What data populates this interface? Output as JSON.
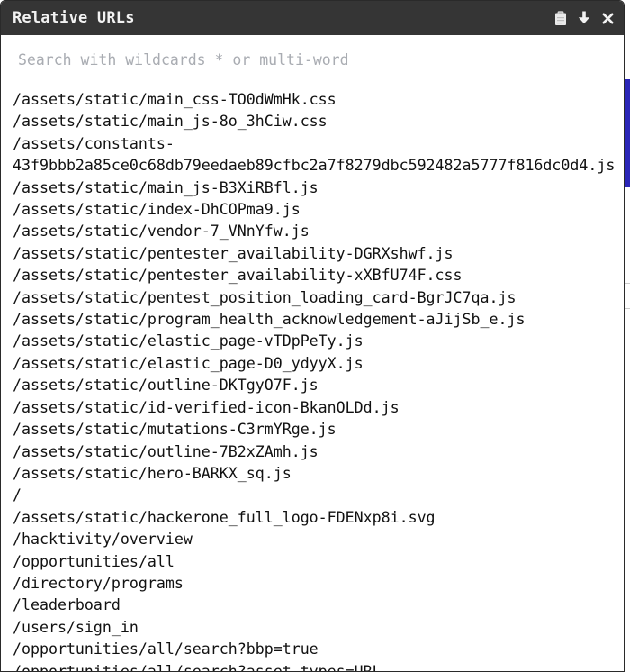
{
  "panel": {
    "title": "Relative URLs",
    "icons": [
      "clipboard-icon",
      "download-icon",
      "close-icon"
    ]
  },
  "search": {
    "placeholder": "Search with wildcards * or multi-word",
    "value": ""
  },
  "urls": [
    "/assets/static/main_css-TO0dWmHk.css",
    "/assets/static/main_js-8o_3hCiw.css",
    "/assets/constants-",
    "43f9bbb2a85ce0c68db79eedaeb89cfbc2a7f8279dbc592482a5777f816dc0d4.js",
    "/assets/static/main_js-B3XiRBfl.js",
    "/assets/static/index-DhCOPma9.js",
    "/assets/static/vendor-7_VNnYfw.js",
    "/assets/static/pentester_availability-DGRXshwf.js",
    "/assets/static/pentester_availability-xXBfU74F.css",
    "/assets/static/pentest_position_loading_card-BgrJC7qa.js",
    "/assets/static/program_health_acknowledgement-aJijSb_e.js",
    "/assets/static/elastic_page-vTDpPeTy.js",
    "/assets/static/elastic_page-D0_ydyyX.js",
    "/assets/static/outline-DKTgyO7F.js",
    "/assets/static/id-verified-icon-BkanOLDd.js",
    "/assets/static/mutations-C3rmYRge.js",
    "/assets/static/outline-7B2xZAmh.js",
    "/assets/static/hero-BARKX_sq.js",
    "/",
    "/assets/static/hackerone_full_logo-FDENxp8i.svg",
    "/hacktivity/overview",
    "/opportunities/all",
    "/directory/programs",
    "/leaderboard",
    "/users/sign_in",
    "/opportunities/all/search?bbp=true",
    "/opportunities/all/search?asset_types=URL"
  ]
}
